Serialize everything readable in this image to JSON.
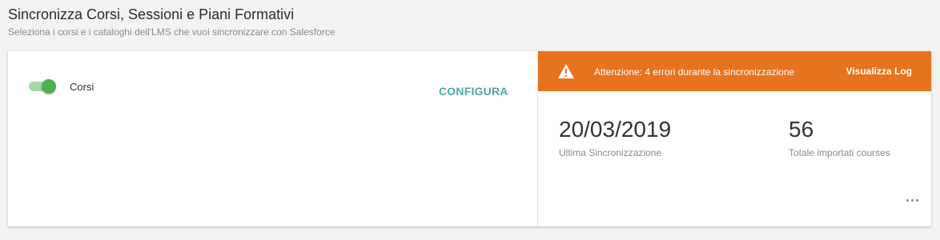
{
  "header": {
    "title": "Sincronizza Corsi, Sessioni e Piani Formativi",
    "subtitle": "Seleziona i corsi e i cataloghi dell'LMS che vuoi sincronizzare con Salesforce"
  },
  "courses_panel": {
    "toggle_label": "Corsi",
    "toggle_on": true,
    "configure_label": "CONFIGURA"
  },
  "sync_panel": {
    "warning": {
      "icon": "warning-icon",
      "text": "Attenzione: 4 errori durante la sincronizzazione",
      "view_log_label": "Visualizza Log"
    },
    "last_sync": {
      "value": "20/03/2019",
      "label": "Ultima Sincronizzazione"
    },
    "total_imported": {
      "value": "56",
      "label": "Totale importati courses"
    },
    "more_icon": "ellipsis-icon"
  },
  "colors": {
    "accent": "#4fa6a6",
    "warning": "#e8731f",
    "toggle_on": "#4caf50",
    "background": "#f3f3f3"
  }
}
